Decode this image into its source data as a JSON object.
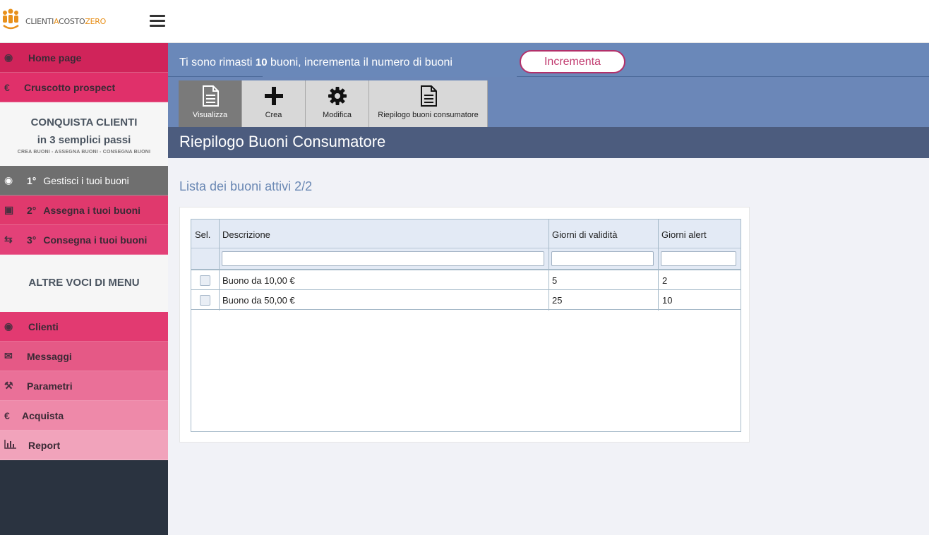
{
  "brand": {
    "logo_text_a": "CLIENTI",
    "logo_text_b": "A",
    "logo_text_c": "COSTO",
    "logo_text_d": "ZERO"
  },
  "sidebar": {
    "top_items": [
      {
        "label": "Home page",
        "icon": "users-icon",
        "color": "#d0245a"
      },
      {
        "label": "Cruscotto prospect",
        "icon": "euro-icon",
        "color": "#e0306a"
      }
    ],
    "conquista": {
      "title1": "CONQUISTA CLIENTI",
      "title2": "in 3 semplici passi",
      "steps": "CREA BUONI - ASSEGNA BUONI - CONSEGNA BUONI"
    },
    "steps": [
      {
        "num": "1°",
        "label": "Gestisci i tuoi buoni",
        "icon": "users-icon",
        "color": "#6f6f6f",
        "active": true
      },
      {
        "num": "2°",
        "label": "Assegna i tuoi buoni",
        "icon": "gift-icon",
        "color": "#e0396d"
      },
      {
        "num": "3°",
        "label": "Consegna i tuoi buoni",
        "icon": "exchange-icon",
        "color": "#e34178"
      }
    ],
    "altre_title": "ALTRE VOCI DI MENU",
    "menu": [
      {
        "label": "Clienti",
        "icon": "users-icon",
        "color": "#e23a71"
      },
      {
        "label": "Messaggi",
        "icon": "envelope-icon",
        "color": "#e55986"
      },
      {
        "label": "Parametri",
        "icon": "tools-icon",
        "color": "#ea7098"
      },
      {
        "label": "Acquista",
        "icon": "euro-icon",
        "color": "#ee89a9"
      },
      {
        "label": "Report",
        "icon": "bar-chart-icon",
        "color": "#f1a3bb"
      }
    ]
  },
  "banner": {
    "text_before": "Ti sono rimasti ",
    "count": "10",
    "text_after": " buoni, incrementa il numero di buoni",
    "button": "Incrementa"
  },
  "toolbar": [
    {
      "label": "Visualizza",
      "icon": "document-icon",
      "active": true
    },
    {
      "label": "Crea",
      "icon": "plus-icon"
    },
    {
      "label": "Modifica",
      "icon": "gear-icon"
    },
    {
      "label": "Riepilogo buoni consumatore",
      "icon": "document-icon"
    }
  ],
  "page_title": "Riepilogo Buoni Consumatore",
  "list_title": "Lista dei buoni attivi 2/2",
  "table": {
    "headers": [
      "Sel.",
      "Descrizione",
      "Giorni di validità",
      "Giorni alert"
    ],
    "rows": [
      {
        "descrizione": "Buono da 10,00 €",
        "validita": "5",
        "alert": "2"
      },
      {
        "descrizione": "Buono da 50,00 €",
        "validita": "25",
        "alert": "10"
      }
    ]
  }
}
